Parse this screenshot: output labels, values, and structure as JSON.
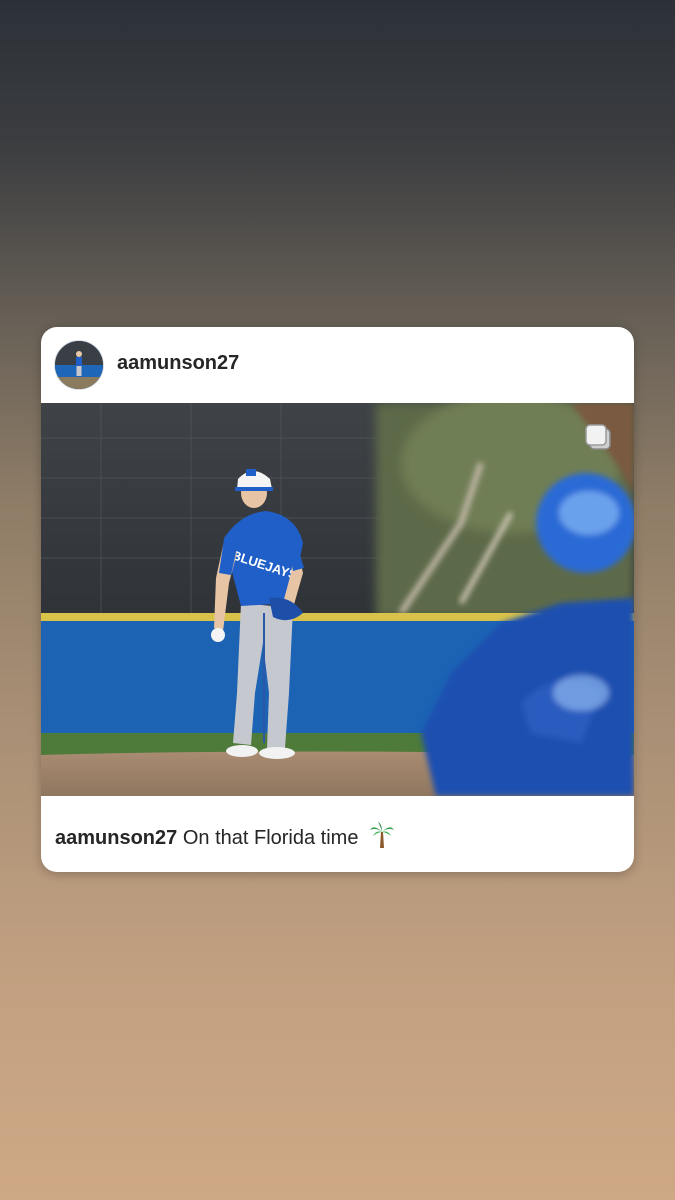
{
  "post": {
    "username": "aamunson27",
    "caption_user": "aamunson27",
    "caption_text": "On that Florida time",
    "caption_emoji": "palm-tree"
  },
  "photo": {
    "jersey_text": "BLUEJAYS",
    "icon": "multiple-photos-icon"
  },
  "colors": {
    "card": "#ffffff",
    "username": "#262626",
    "jersey_blue": "#1f5fc7",
    "wall_blue": "#1e66b8"
  }
}
